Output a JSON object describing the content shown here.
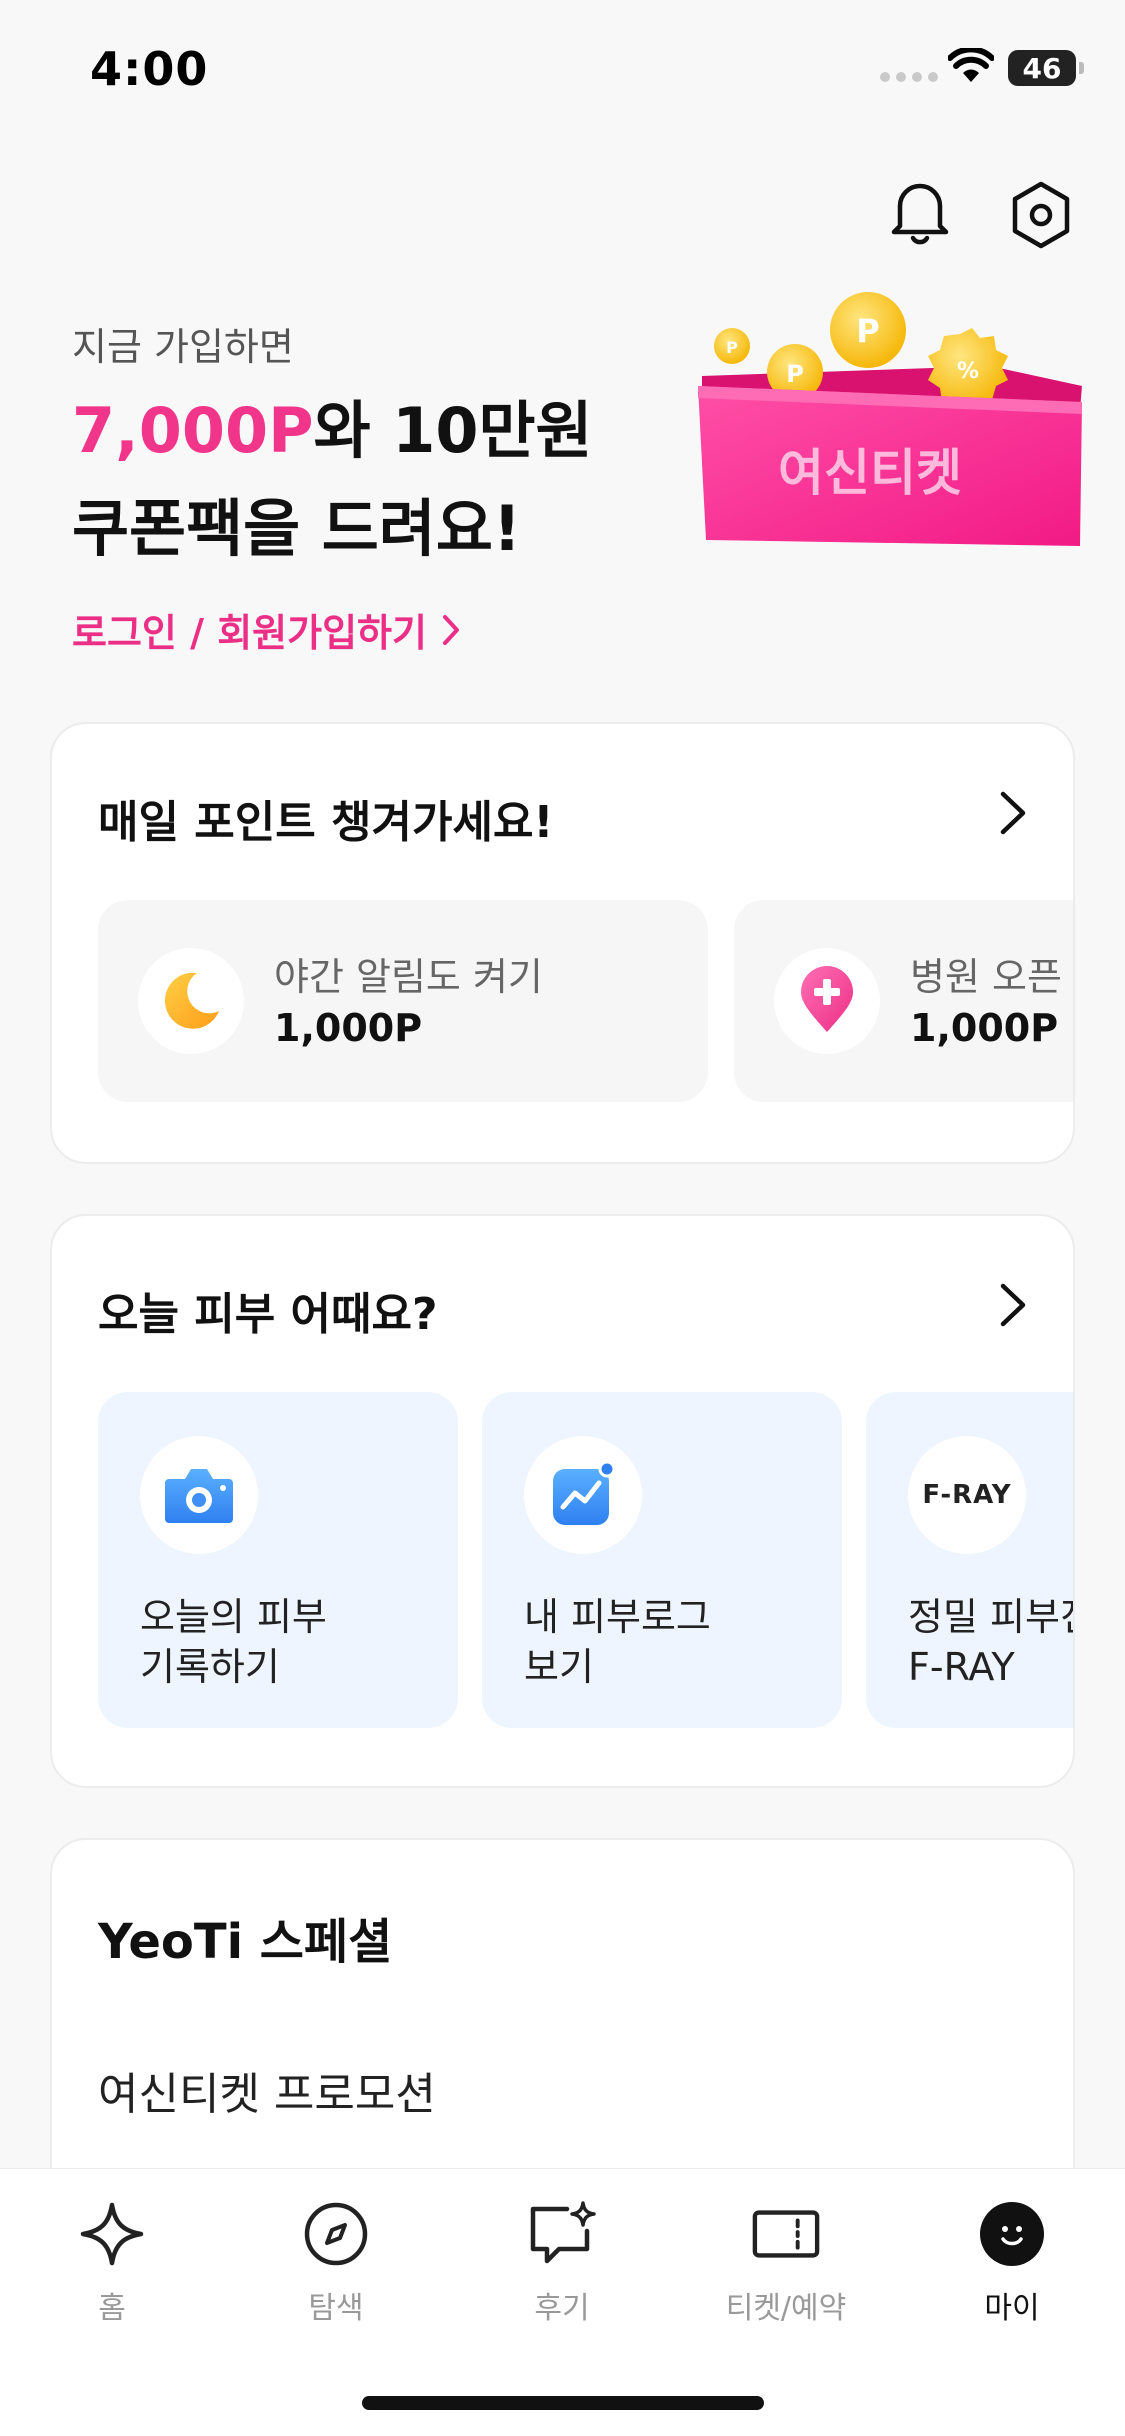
{
  "status_bar": {
    "time": "4:00",
    "battery": "46"
  },
  "header": {
    "bell_icon": "bell-icon",
    "settings_icon": "settings-icon"
  },
  "promo": {
    "subtitle": "지금 가입하면",
    "highlight": "7,000P",
    "line1_rest": "와 10만원",
    "line2": "쿠폰팩을 드려요!",
    "link_label": "로그인 / 회원가입하기",
    "box_brand": "여신티켓",
    "colors": {
      "accent": "#f0358b"
    }
  },
  "points_card": {
    "title": "매일 포인트 챙겨가세요!",
    "items": [
      {
        "icon": "moon-icon",
        "label": "야간 알림도 켜기",
        "value": "1,000P"
      },
      {
        "icon": "hospital-pin-icon",
        "label": "병원 오픈 알",
        "value": "1,000P"
      }
    ]
  },
  "skin_card": {
    "title": "오늘 피부 어때요?",
    "items": [
      {
        "icon": "camera-icon",
        "line1": "오늘의 피부",
        "line2": "기록하기"
      },
      {
        "icon": "chart-icon",
        "line1": "내 피부로그",
        "line2": "보기"
      },
      {
        "icon": "fray-logo",
        "logo_text": "F-RAY",
        "line1": "정밀 피부진",
        "line2": "F-RAY"
      }
    ]
  },
  "special_card": {
    "title": "YeoTi 스페셜",
    "item": "여신티켓 프로모션"
  },
  "tabbar": {
    "tabs": [
      {
        "icon": "sparkle-icon",
        "label": "홈"
      },
      {
        "icon": "compass-icon",
        "label": "탐색"
      },
      {
        "icon": "review-icon",
        "label": "후기"
      },
      {
        "icon": "ticket-icon",
        "label": "티켓/예약"
      },
      {
        "icon": "profile-icon",
        "label": "마이",
        "active": true
      }
    ]
  }
}
